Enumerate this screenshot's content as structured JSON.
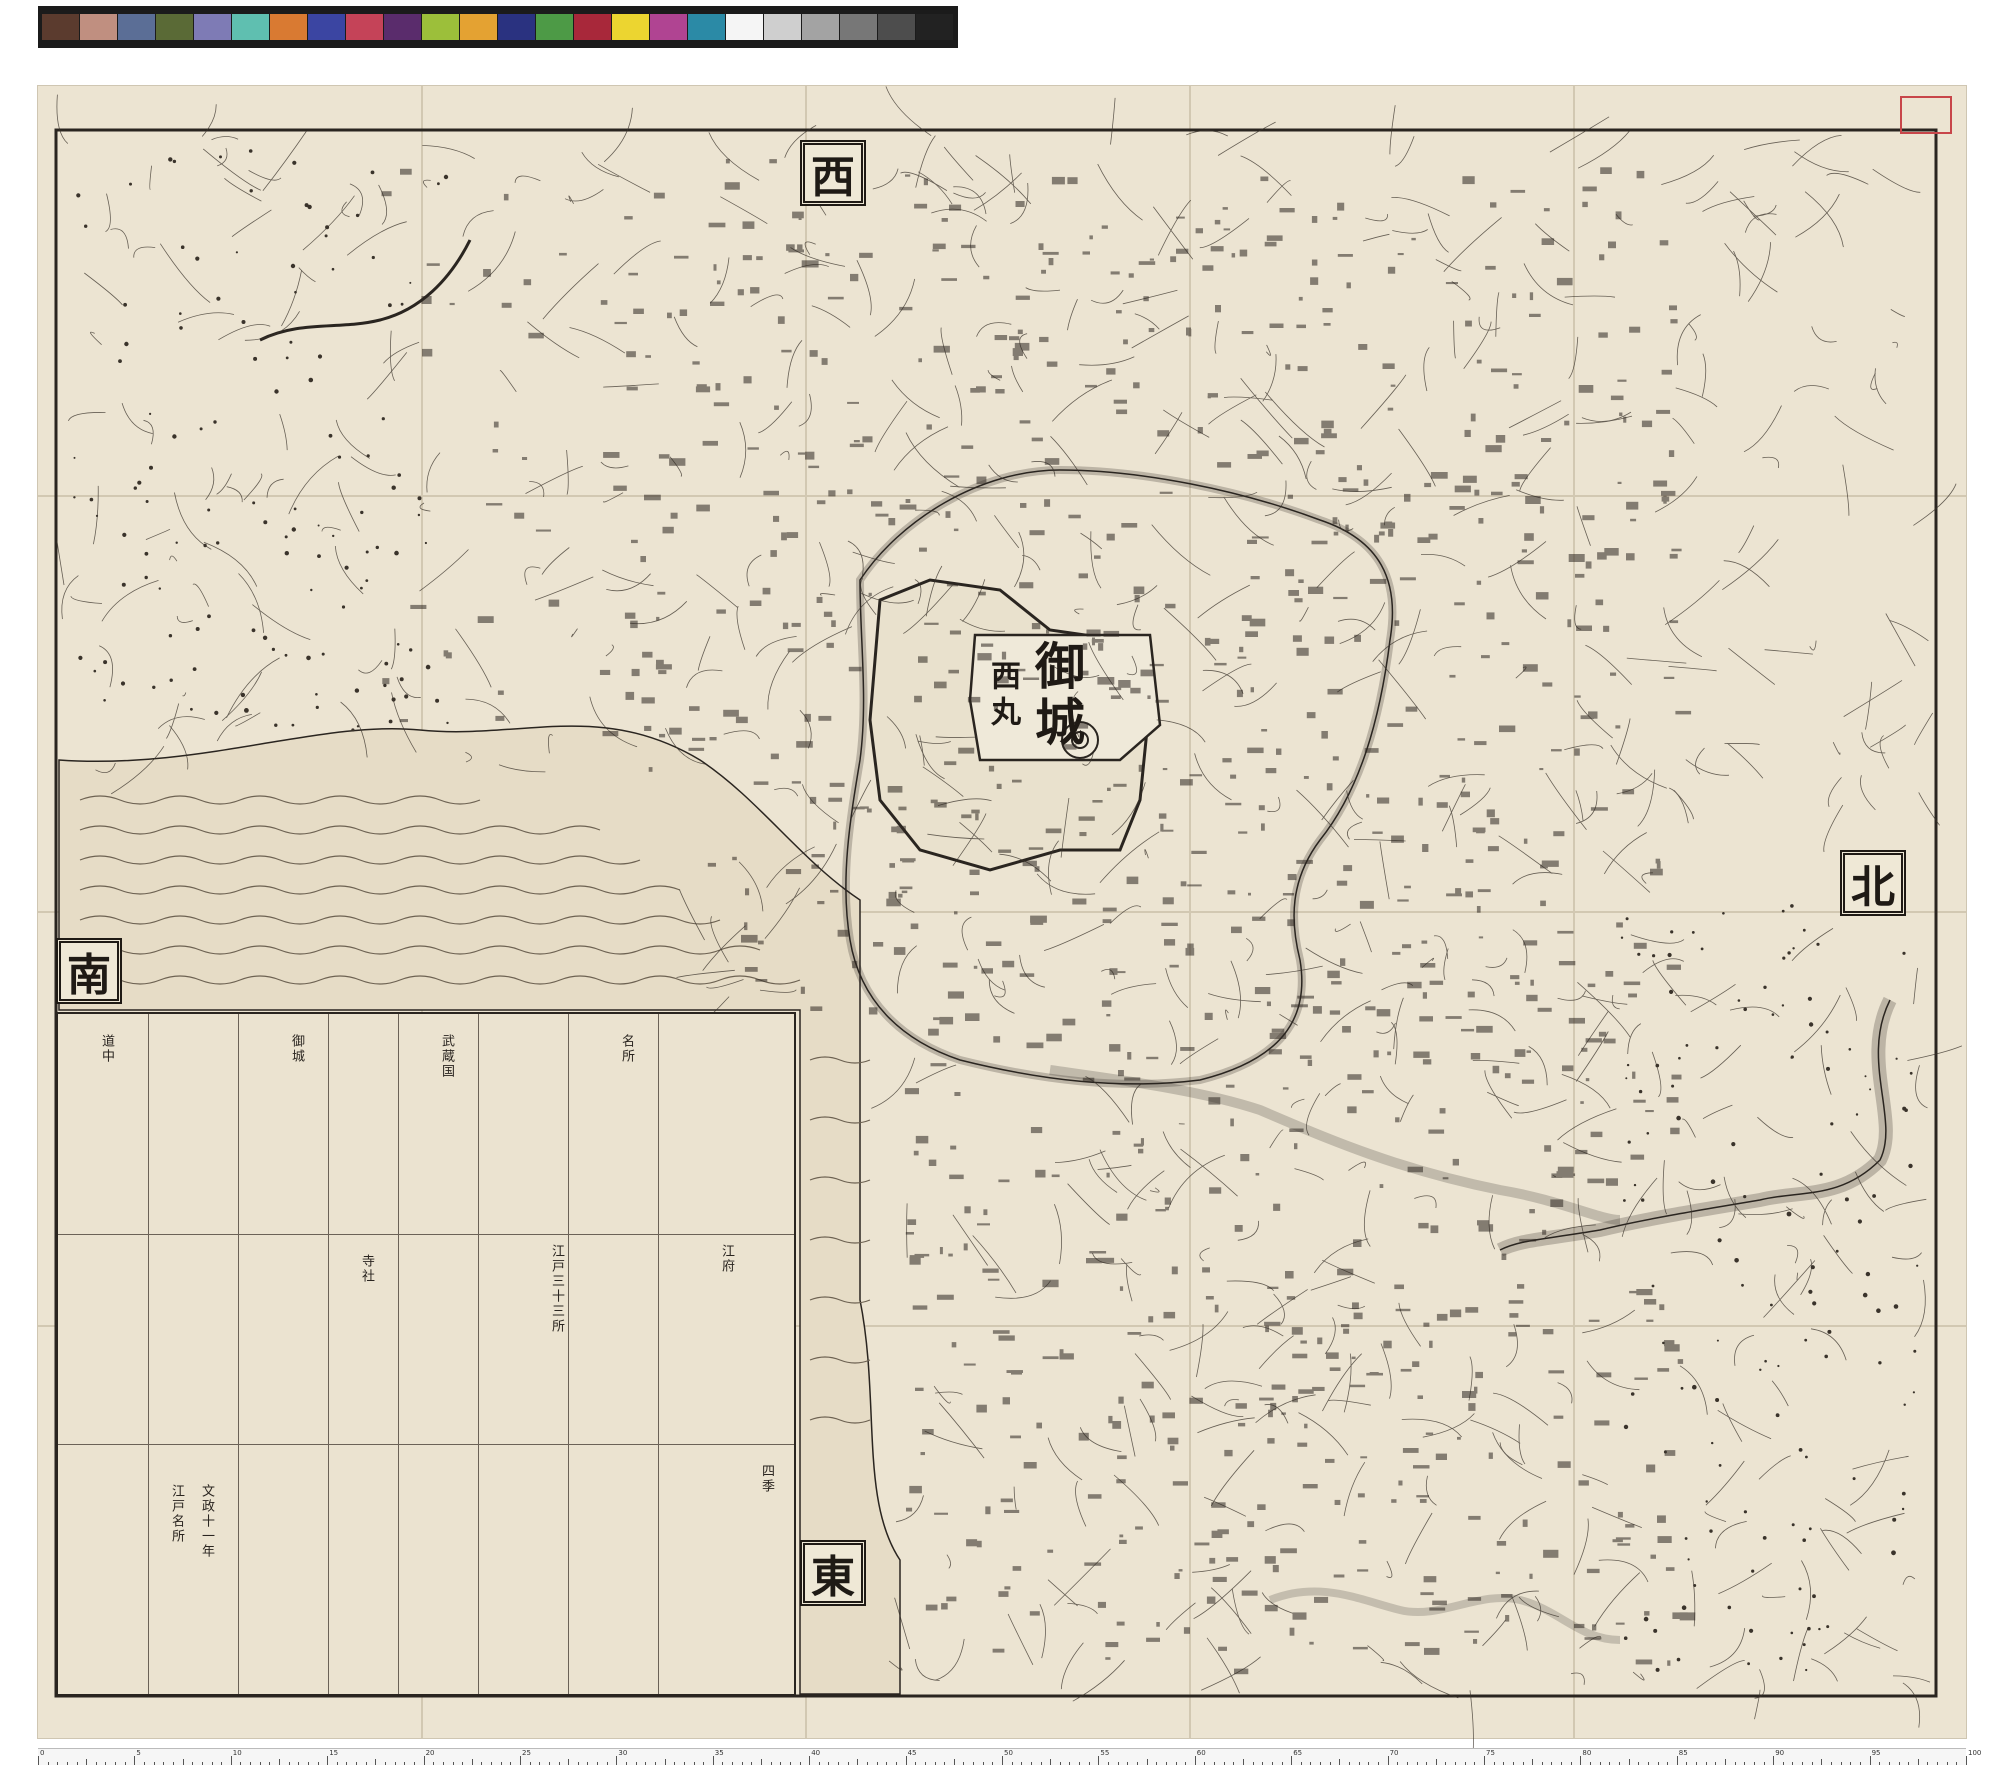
{
  "calibration": {
    "label": "",
    "swatches": [
      "#5b3b2e",
      "#c08f80",
      "#5b6e96",
      "#5a6a36",
      "#7e7bb5",
      "#5fbfb0",
      "#d97a32",
      "#3b45a2",
      "#c54358",
      "#5a2c6c",
      "#9cbf3a",
      "#e4a232",
      "#2a3280",
      "#4d9a46",
      "#a8283a",
      "#ecd530",
      "#b04492",
      "#2b8aa6",
      "#f5f5f5",
      "#cfcfcf",
      "#a3a3a3",
      "#777777",
      "#4d4d4d",
      "#222222"
    ]
  },
  "map": {
    "directions": {
      "west": "西",
      "north": "北",
      "south": "南",
      "east": "東"
    },
    "castle": "御城",
    "castle_sub": "西丸",
    "stamp": "",
    "colors": {
      "paper": "#ece4d2",
      "ink": "#2a2520",
      "water": "#e8dfcb",
      "seal": "#c8464a"
    }
  },
  "legend": {
    "col_texts": [
      "文政十一年",
      "江戸名所",
      "四季",
      "江戸三十三所",
      "江府",
      "道中",
      "御城",
      "武蔵国",
      "名所",
      "寺社"
    ]
  },
  "ruler": {
    "marks": [
      "0",
      "5",
      "10",
      "15",
      "20",
      "25",
      "30",
      "35",
      "40",
      "45",
      "50",
      "55",
      "60",
      "65",
      "70",
      "75",
      "80",
      "85",
      "90",
      "95",
      "100"
    ]
  }
}
